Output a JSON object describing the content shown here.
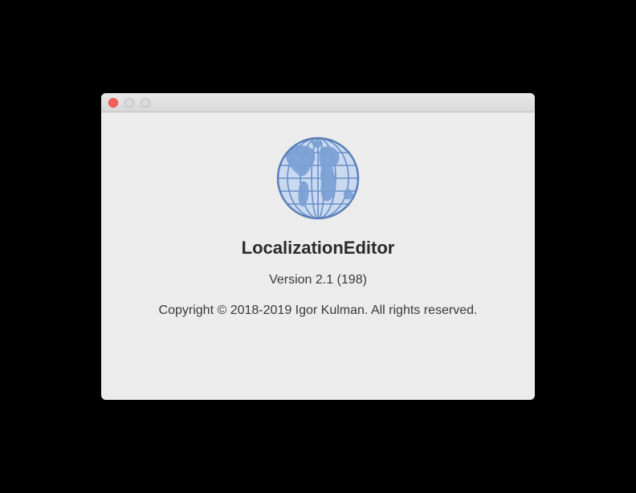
{
  "about": {
    "app_name": "LocalizationEditor",
    "version_text": "Version 2.1 (198)",
    "copyright_text": "Copyright © 2018-2019 Igor Kulman. All rights reserved."
  }
}
